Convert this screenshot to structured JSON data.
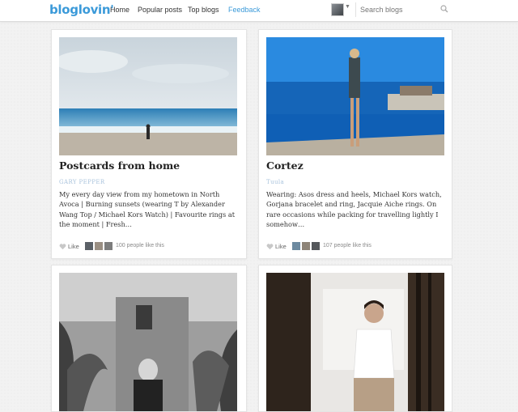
{
  "header": {
    "logo": "bloglovin'",
    "nav": {
      "home": "Home",
      "popular": "Popular posts",
      "top_blogs": "Top blogs",
      "feedback": "Feedback"
    },
    "search_placeholder": "Search blogs",
    "accent_color": "#3b9ad9"
  },
  "posts": [
    {
      "title": "Postcards from home",
      "blog": "GARY PEPPER",
      "description": "My every day view from my hometown in North Avoca | Burning sunsets (wearing T by Alexander Wang Top / Michael Kors Watch) | Favourite rings at the moment | Fresh…",
      "like_label": "Like",
      "likes_text": "100 people like this",
      "image": "beach-photo"
    },
    {
      "title": "Cortez",
      "blog": "Tuula",
      "description": "Wearing: Asos dress and heels, Michael Kors watch, Gorjana bracelet and ring, Jacquie Aiche rings. On rare occasions while packing for travelling lightly I somehow…",
      "like_label": "Like",
      "likes_text": "107 people like this",
      "image": "poolside-photo"
    },
    {
      "image": "palm-courtyard-photo"
    },
    {
      "image": "white-top-portrait-photo"
    }
  ]
}
